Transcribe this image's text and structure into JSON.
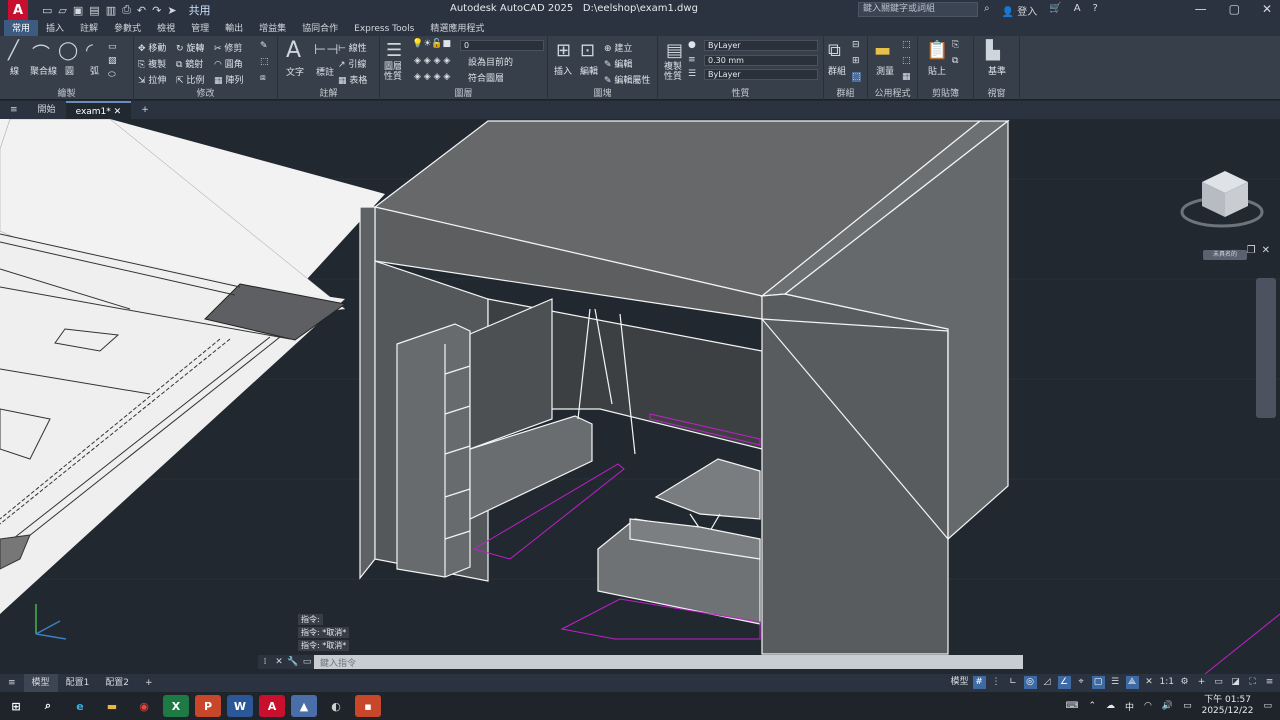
{
  "app": {
    "logo": "A",
    "title": "Autodesk AutoCAD 2025",
    "file_path": "D:\\eelshop\\exam1.dwg",
    "share_label": "共用",
    "search_placeholder": "鍵入關鍵字或詞組",
    "signin_label": "登入"
  },
  "ribbon_tabs": [
    "常用",
    "插入",
    "註解",
    "參數式",
    "檢視",
    "管理",
    "輸出",
    "增益集",
    "協同合作",
    "Express Tools",
    "精選應用程式"
  ],
  "ribbon": {
    "draw": {
      "label": "繪製",
      "line": "線",
      "polyline": "聚合線",
      "circle": "圓",
      "arc": "弧"
    },
    "modify": {
      "label": "修改",
      "move": "移動",
      "rotate": "旋轉",
      "trim": "修剪",
      "copy": "複製",
      "mirror": "鏡射",
      "fillet": "圓角",
      "stretch": "拉伸",
      "scale": "比例",
      "array": "陣列"
    },
    "annotation": {
      "label": "註解",
      "text": "文字",
      "dimension": "標註",
      "linear": "線性",
      "leader": "引線",
      "table": "表格"
    },
    "layers": {
      "label": "圖層",
      "layer_props": "圖層性質",
      "layer_value": "0",
      "set_current": "設為目前的",
      "match_layer": "符合圖層"
    },
    "block": {
      "label": "圖塊",
      "insert": "插入",
      "edit": "編輯",
      "create": "建立",
      "edit_block": "編輯",
      "edit_attr": "編輯屬性"
    },
    "properties": {
      "label": "性質",
      "match_props": "複製性質",
      "color": "ByLayer",
      "lineweight": "0.30 mm",
      "linetype": "ByLayer"
    },
    "groups": {
      "label": "群組",
      "group": "群組"
    },
    "utilities": {
      "label": "公用程式",
      "measure": "測量"
    },
    "clipboard": {
      "label": "剪貼簿",
      "paste": "貼上"
    },
    "view": {
      "label": "視窗",
      "base": "基準"
    }
  },
  "doc_tabs": {
    "menu_icon": "≡",
    "start": "開始",
    "active": "exam1*",
    "add": "+"
  },
  "viewcube": {
    "label": "未具名的"
  },
  "command": {
    "history": [
      "指令:",
      "指令: *取消*",
      "指令: *取消*"
    ],
    "placeholder": "鍵入指令"
  },
  "status": {
    "layouts": [
      "模型",
      "配置1",
      "配置2"
    ],
    "model_label": "模型",
    "scale": "1:1"
  },
  "taskbar": {
    "time": "下午 01:57",
    "date": "2025/12/22"
  },
  "colors": {
    "accent": "#3d6aa3",
    "autocad_red": "#c8102e",
    "viewport_bg": "#212830",
    "model_fill": "#5f6265",
    "magenta": "#c020c8"
  }
}
